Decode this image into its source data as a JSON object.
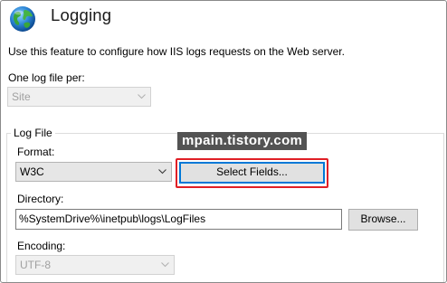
{
  "header": {
    "title": "Logging",
    "description": "Use this feature to configure how IIS logs requests on the Web server."
  },
  "log_file_per": {
    "label": "One log file per:",
    "value": "Site"
  },
  "log_file": {
    "group_title": "Log File",
    "format_label": "Format:",
    "format_value": "W3C",
    "select_fields_label": "Select Fields...",
    "directory_label": "Directory:",
    "directory_value": "%SystemDrive%\\inetpub\\logs\\LogFiles",
    "browse_label": "Browse...",
    "encoding_label": "Encoding:",
    "encoding_value": "UTF-8"
  },
  "watermark": "mpain.tistory.com",
  "colors": {
    "highlight": "#e01f26",
    "default_button_border": "#0078d7",
    "watermark_bg": "#535353"
  },
  "icons": [
    "globe-icon",
    "chevron-down-icon"
  ]
}
